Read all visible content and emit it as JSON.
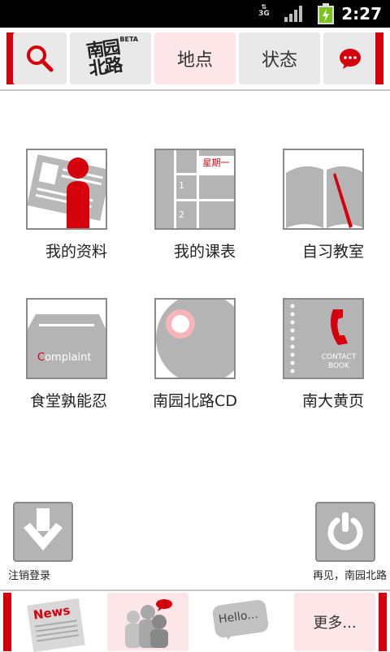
{
  "status": {
    "network": "3G",
    "time": "2:27"
  },
  "header": {
    "logo_text": "南园北路",
    "logo_badge": "BETA",
    "tab_location": "地点",
    "tab_status": "状态"
  },
  "grid": {
    "items": [
      {
        "label": "我的资料"
      },
      {
        "label": "我的课表",
        "schedule_day": "星期一",
        "rows": [
          "1",
          "2"
        ]
      },
      {
        "label": "自习教室"
      },
      {
        "label": "食堂孰能忍",
        "complaint_text": "Complaint"
      },
      {
        "label": "南园北路CD"
      },
      {
        "label": "南大黄页",
        "contact_line1": "CONTACT",
        "contact_line2": "BOOK"
      }
    ]
  },
  "actions": {
    "logout": "注销登录",
    "exit": "再见，南园北路"
  },
  "bottom": {
    "news_text": "News",
    "hello_text": "Hello...",
    "more": "更多..."
  },
  "colors": {
    "accent": "#d4000b",
    "tile_gray": "#e9e9e9",
    "tile_pink": "#fde6e7",
    "icon_gray": "#b4b4b4"
  }
}
